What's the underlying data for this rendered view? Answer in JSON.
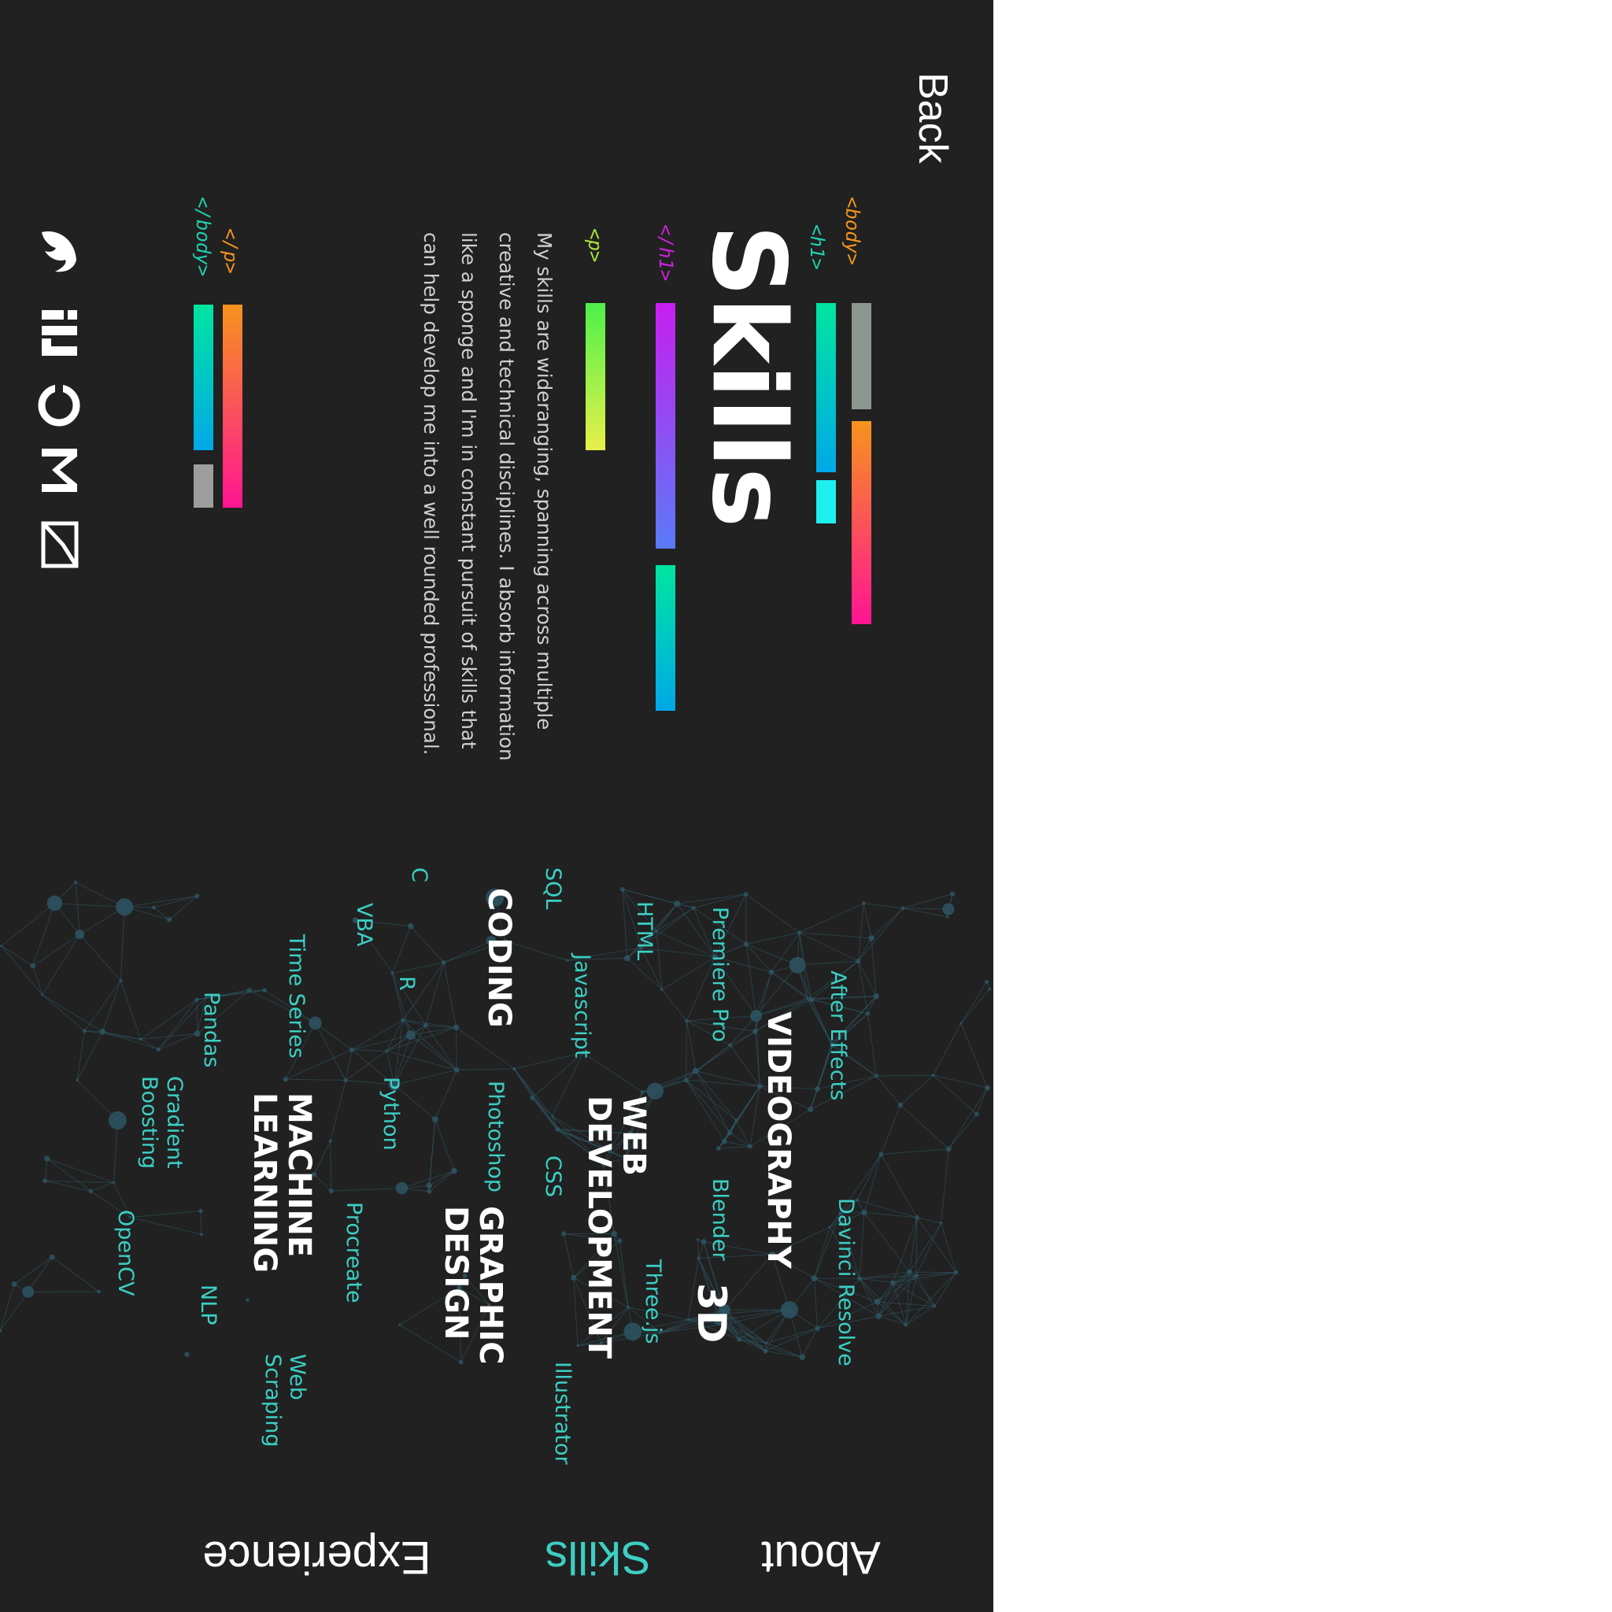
{
  "nav": {
    "back": "Back",
    "about": "About",
    "skills": "Skills",
    "experience": "Experience"
  },
  "tags": {
    "body_open": "<body>",
    "h1_open": "<h1>",
    "h1_close": "</h1>",
    "p_open": "<p>",
    "p_close": "</p>",
    "body_close": "</body>"
  },
  "heading": "Skills",
  "intro": {
    "line1": "My skills are wideranging, spanning across multiple",
    "line2": "creative and technical disciplines. I absorb information",
    "line3": "like a sponge and I'm in constant pursuit of skills that",
    "line4": "can help develop me into a well rounded professional."
  },
  "categories": {
    "videography": "VIDEOGRAPHY",
    "web1": "WEB",
    "web2": "DEVELOPMENT",
    "coding": "CODING",
    "graphic1": "GRAPHIC",
    "graphic2": "DESIGN",
    "ml1": "MACHINE",
    "ml2": "LEARNING",
    "three_d": "3D"
  },
  "skills": {
    "after_effects": "After Effects",
    "davinci": "Davinci Resolve",
    "premiere": "Premiere Pro",
    "blender": "Blender",
    "html": "HTML",
    "javascript": "Javascript",
    "threejs": "Three.js",
    "sql": "SQL",
    "css": "CSS",
    "c": "C",
    "photoshop": "Photoshop",
    "illustrator": "Illustrator",
    "vba": "VBA",
    "r": "R",
    "python": "Python",
    "procreate": "Procreate",
    "time_series": "Time Series",
    "web_scraping1": "Web",
    "web_scraping2": "Scraping",
    "pandas": "Pandas",
    "nlp": "NLP",
    "gradient1": "Gradient",
    "gradient2": "Boosting",
    "opencv": "OpenCV"
  },
  "social": [
    "twitter-icon",
    "linkedin-icon",
    "github-icon",
    "medium-icon",
    "email-icon"
  ],
  "colors": {
    "background": "#212121",
    "accent": "#3ccfc4",
    "white_area": "#ffffff"
  }
}
